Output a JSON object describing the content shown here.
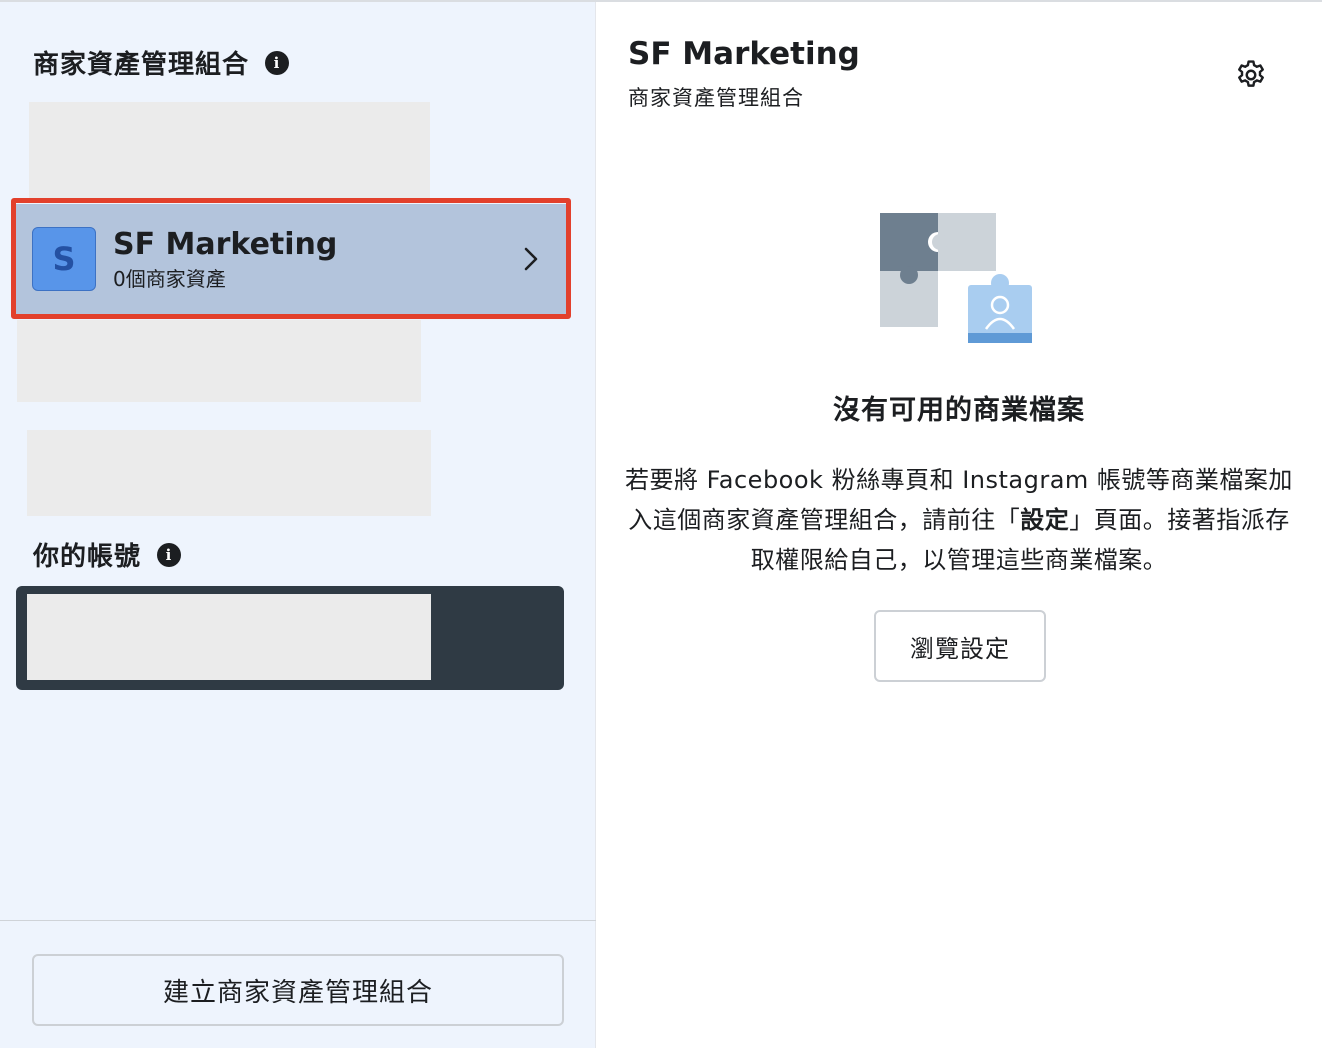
{
  "left_panel": {
    "business_portfolios_heading": "商家資產管理組合",
    "selected_portfolio": {
      "avatar_letter": "S",
      "name": "SF Marketing",
      "asset_count": "0個商家資產"
    },
    "your_account_heading": "你的帳號",
    "create_button_label": "建立商家資產管理組合"
  },
  "right_panel": {
    "title": "SF Marketing",
    "subtitle": "商家資產管理組合",
    "empty_state": {
      "title": "沒有可用的商業檔案",
      "desc_part1": "若要將 Facebook 粉絲專頁和 Instagram 帳號等商業檔案加入這個商家資產管理組合，請前往「",
      "desc_bold": "設定",
      "desc_part2": "」頁面。接著指派存取權限給自己，以管理這些商業檔案。",
      "button_label": "瀏覽設定"
    }
  },
  "icons": {
    "info": "info-icon",
    "chevron": "chevron-right-icon",
    "settings": "gear-icon",
    "illustration": "puzzle-illustration"
  },
  "colors": {
    "left_panel_bg": "#eef4fd",
    "selected_item_bg": "#b3c4dc",
    "highlight_border": "#e2402c",
    "avatar_bg": "#5895e9",
    "account_box_bg": "#2f3a44"
  }
}
